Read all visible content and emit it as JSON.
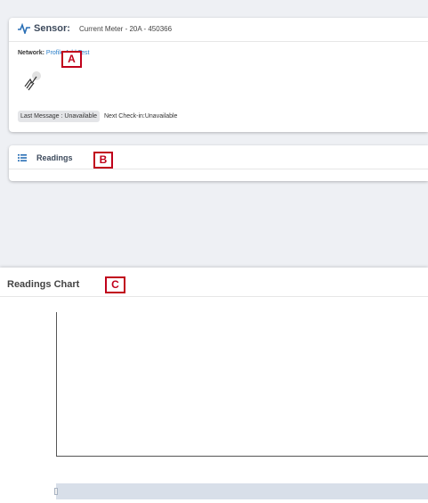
{
  "sensor": {
    "title": "Sensor:",
    "name": "Current Meter - 20A - 450366",
    "network_label": "Network:",
    "network_link": "Profile Add Test",
    "last_message": "Last Message : Unavailable",
    "next_checkin": "Next Check-in:Unavailable",
    "icons": [
      "pulse-icon",
      "signal-icon"
    ]
  },
  "readings": {
    "title": "Readings",
    "icon": "list-icon"
  },
  "chart": {
    "title": "Readings Chart"
  },
  "markers": {
    "a": "A",
    "b": "B",
    "c": "C"
  },
  "colors": {
    "background": "#eef0f4",
    "marker": "#c0001b",
    "link": "#2a7fc9",
    "navigator": "#d8dfe9"
  }
}
